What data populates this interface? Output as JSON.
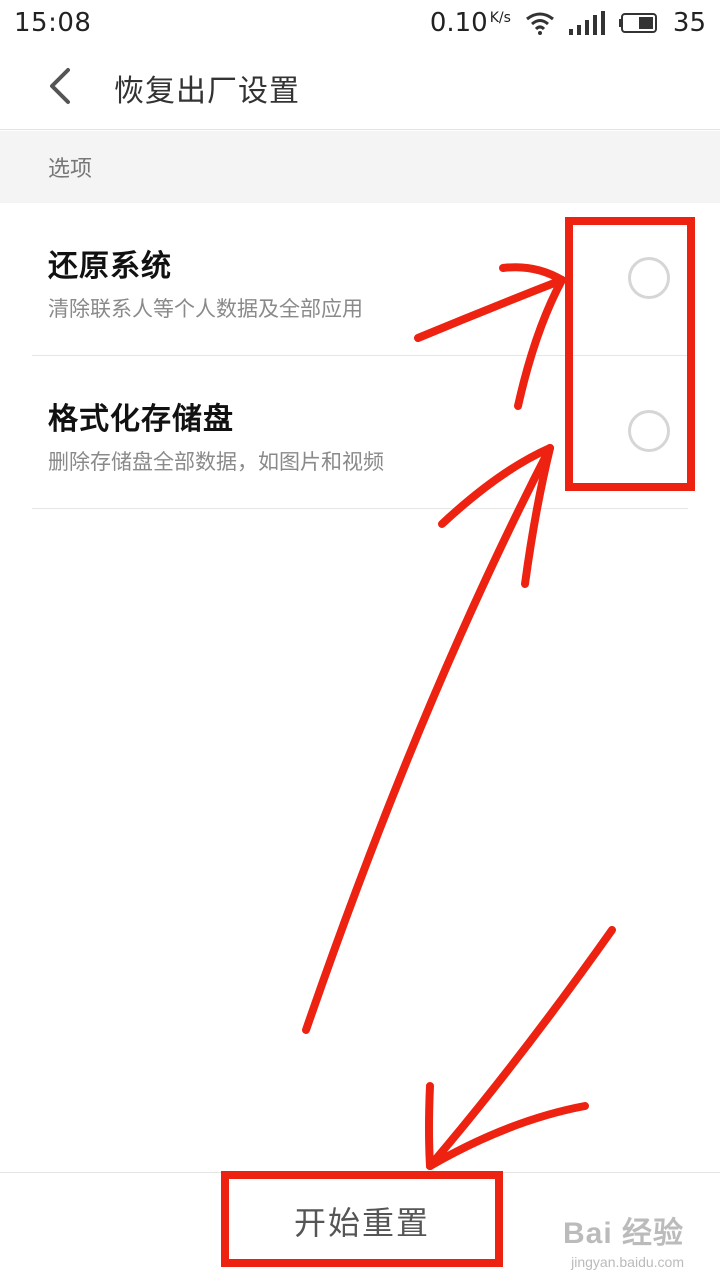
{
  "status_bar": {
    "time": "15:08",
    "net_speed": "0.10",
    "net_unit": "K/s",
    "battery": "35"
  },
  "header": {
    "title": "恢复出厂设置"
  },
  "section": {
    "label": "选项"
  },
  "options": [
    {
      "title": "还原系统",
      "description": "清除联系人等个人数据及全部应用",
      "selected": false
    },
    {
      "title": "格式化存储盘",
      "description": "删除存储盘全部数据，如图片和视频",
      "selected": false
    }
  ],
  "footer": {
    "reset_label": "开始重置"
  },
  "watermark": {
    "brand": "Bai 经验",
    "url": "jingyan.baidu.com"
  },
  "colors": {
    "annotation": "#ee2211",
    "radio_border": "#d6d6d6"
  }
}
